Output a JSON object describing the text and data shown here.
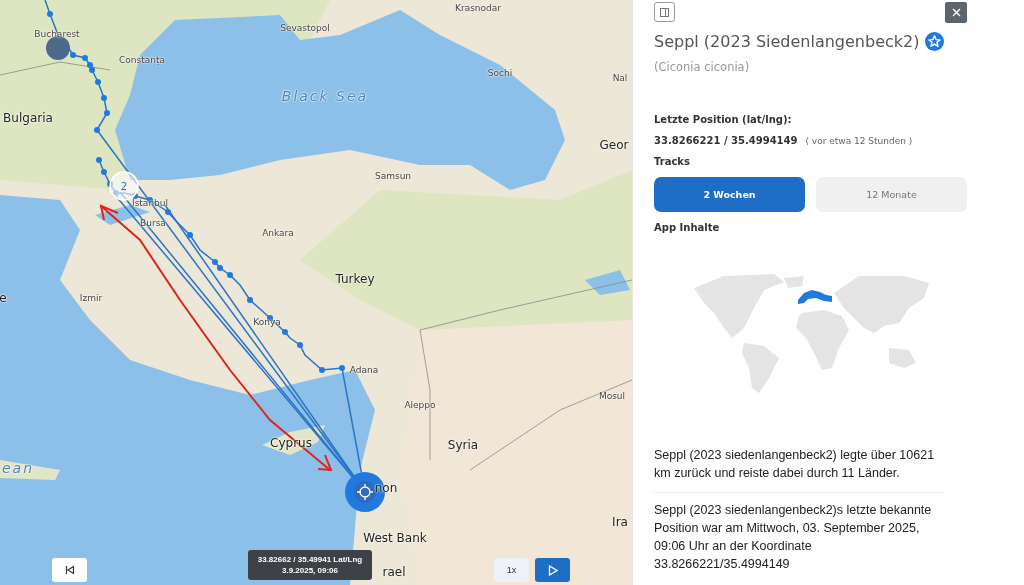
{
  "map": {
    "labels": [
      {
        "text": "Krasnodar",
        "kind": "city"
      },
      {
        "text": "Sevastopol",
        "kind": "city"
      },
      {
        "text": "Bucharest",
        "kind": "city"
      },
      {
        "text": "Constanța",
        "kind": "city"
      },
      {
        "text": "Sochi",
        "kind": "city"
      },
      {
        "text": "Nal",
        "kind": "city"
      },
      {
        "text": "Black Sea",
        "kind": "sea"
      },
      {
        "text": "Bulgaria",
        "kind": "country"
      },
      {
        "text": "Geor",
        "kind": "country"
      },
      {
        "text": "Samsun",
        "kind": "city"
      },
      {
        "text": "Istanbul",
        "kind": "city"
      },
      {
        "text": "Bursa",
        "kind": "city"
      },
      {
        "text": "Ankara",
        "kind": "city"
      },
      {
        "text": "Turkey",
        "kind": "country"
      },
      {
        "text": "e",
        "kind": "country"
      },
      {
        "text": "Izmir",
        "kind": "city"
      },
      {
        "text": "Konya",
        "kind": "city"
      },
      {
        "text": "Adana",
        "kind": "city"
      },
      {
        "text": "Aleppo",
        "kind": "city"
      },
      {
        "text": "Mosul",
        "kind": "city"
      },
      {
        "text": "Cyprus",
        "kind": "country"
      },
      {
        "text": "Syria",
        "kind": "country"
      },
      {
        "text": "ean",
        "kind": "sea"
      },
      {
        "text": "non",
        "kind": "country"
      },
      {
        "text": "Ira",
        "kind": "country"
      },
      {
        "text": "West Bank",
        "kind": "country"
      },
      {
        "text": "rael",
        "kind": "country"
      }
    ],
    "cluster_count": "2",
    "tooltip": {
      "coords": "33.82662 / 35.49941 Lat/Lng",
      "time": "3.9.2025, 09:06"
    },
    "controls": {
      "speed": "1x"
    }
  },
  "panel": {
    "title": "Seppl (2023 Siedenlangenbeck2)",
    "favorite": true,
    "species": "(Ciconia ciconia)",
    "position_label": "Letzte Position (lat/lng):",
    "position_value": "33.8266221 / 35.4994149",
    "position_age": "( vor etwa 12 Stunden )",
    "tracks_label": "Tracks",
    "tracks": [
      {
        "label": "2 Wochen",
        "selected": true
      },
      {
        "label": "12 Monate",
        "selected": false
      }
    ],
    "app_contents_label": "App Inhalte",
    "paragraphs": [
      "Seppl (2023 siedenlangenbeck2) legte über 10621 km zurück und reiste dabei durch 11 Länder.",
      "Seppl (2023 siedenlangenbeck2)s letzte bekannte Position war am Mittwoch, 03. September 2025, 09:06 Uhr an der Koordinate 33.8266221/35.4994149"
    ]
  }
}
